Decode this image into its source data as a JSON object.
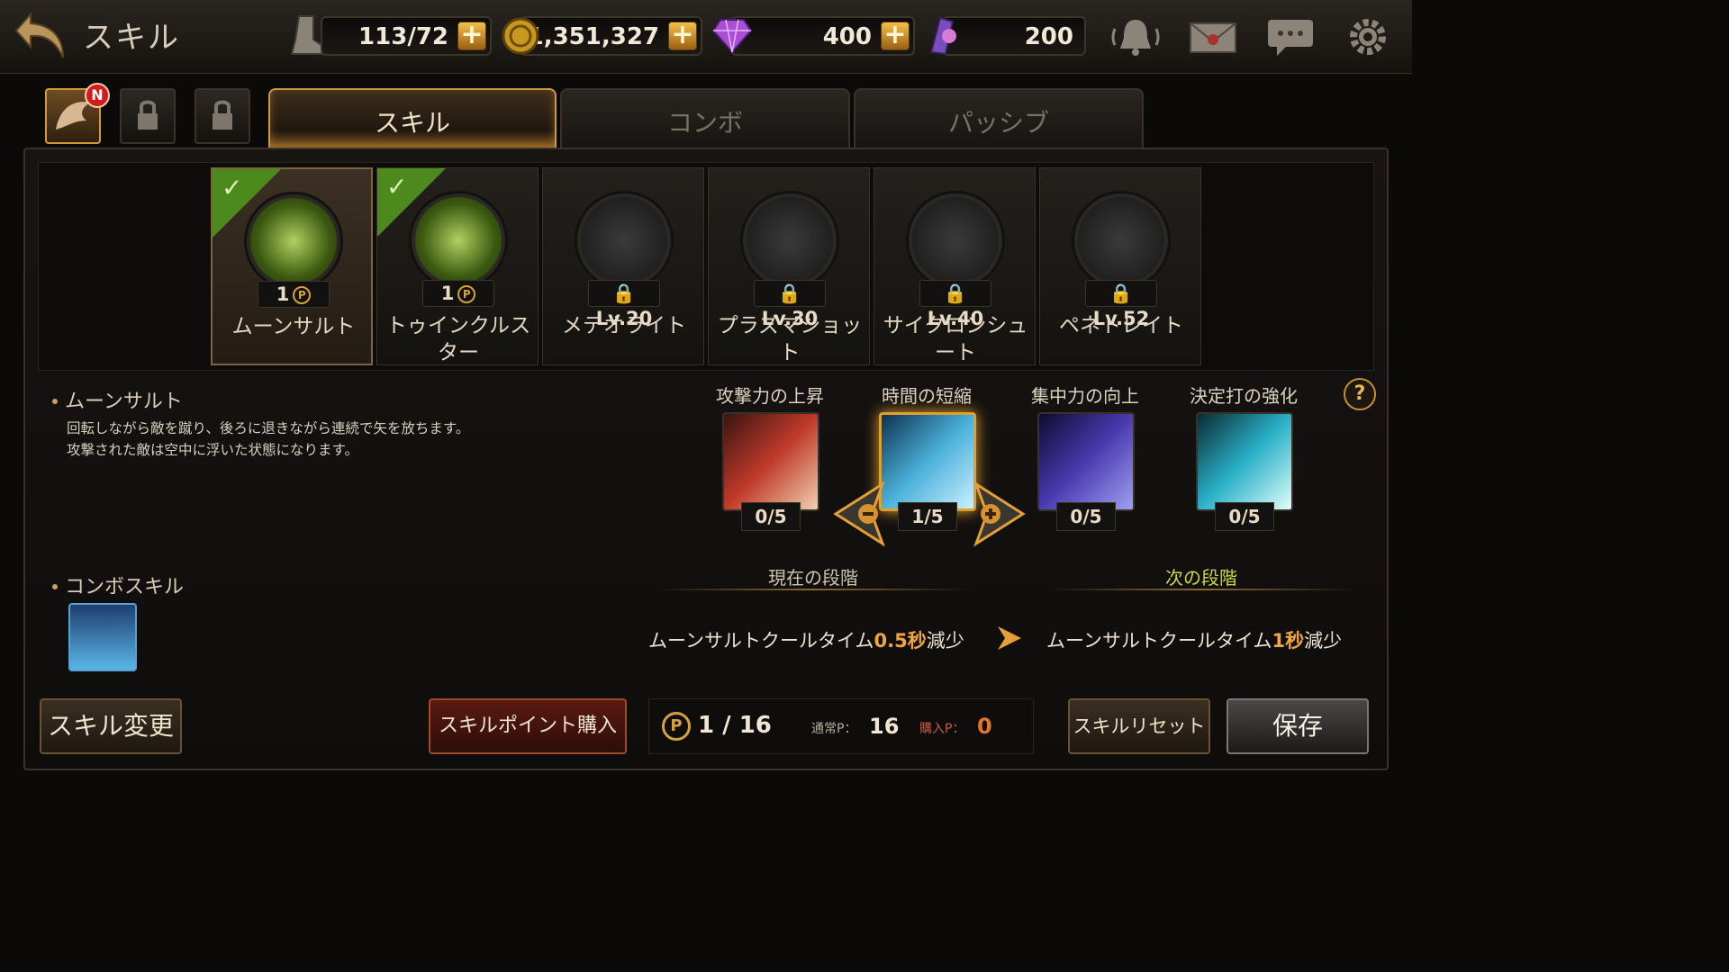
{
  "header": {
    "title": "スキル",
    "stamina": "113/72",
    "gold": "1,351,327",
    "gems": "400",
    "tickets": "200",
    "icons": [
      "back-icon",
      "boot-icon",
      "coin-icon",
      "gem-icon",
      "ticket-icon",
      "bell-icon",
      "mail-icon",
      "chat-icon",
      "gear-icon"
    ]
  },
  "character_tabs": {
    "badge": "N"
  },
  "tabs": [
    {
      "label": "スキル",
      "active": true
    },
    {
      "label": "コンボ",
      "active": false
    },
    {
      "label": "パッシブ",
      "active": false
    }
  ],
  "skills": [
    {
      "name": "ムーンサルト",
      "level_text": "1",
      "unlocked": true,
      "selected": true
    },
    {
      "name": "トゥインクルス\nター",
      "level_text": "1",
      "unlocked": true,
      "selected": false
    },
    {
      "name": "メテオライト",
      "level_text": "Lv.20",
      "unlocked": false,
      "selected": false
    },
    {
      "name": "プラズマショッ\nト",
      "level_text": "Lv.30",
      "unlocked": false,
      "selected": false
    },
    {
      "name": "サイクロンシュ\nート",
      "level_text": "Lv.40",
      "unlocked": false,
      "selected": false
    },
    {
      "name": "ペネトレイト",
      "level_text": "Lv.52",
      "unlocked": false,
      "selected": false
    }
  ],
  "detail": {
    "skill_name": "ムーンサルト",
    "description_1": "回転しながら敵を蹴り、後ろに退きながら連続で矢を放ちます。",
    "description_2": "攻撃された敵は空中に浮いた状態になります。",
    "combo_title": "コンボスキル"
  },
  "upgrades": [
    {
      "name": "攻撃力の上昇",
      "count": "0/5",
      "color": "#c0392b"
    },
    {
      "name": "時間の短縮",
      "count": "1/5",
      "color": "#3aa0c8",
      "selected": true
    },
    {
      "name": "集中力の向上",
      "count": "0/5",
      "color": "#4a3aa0"
    },
    {
      "name": "決定打の強化",
      "count": "0/5",
      "color": "#2aa0b8"
    }
  ],
  "stage": {
    "current_label": "現在の段階",
    "next_label": "次の段階",
    "current_pre": "ムーンサルトクールタイム",
    "current_val": "0.5秒",
    "current_post": "減少",
    "next_pre": "ムーンサルトクールタイム",
    "next_val": "1秒",
    "next_post": "減少"
  },
  "footer": {
    "skill_change": "スキル変更",
    "buy_points": "スキルポイント購入",
    "points": "1 / 16",
    "normal_label": "通常P：",
    "normal_val": "16",
    "bought_label": "購入P：",
    "bought_val": "0",
    "reset": "スキルリセット",
    "save": "保存"
  }
}
